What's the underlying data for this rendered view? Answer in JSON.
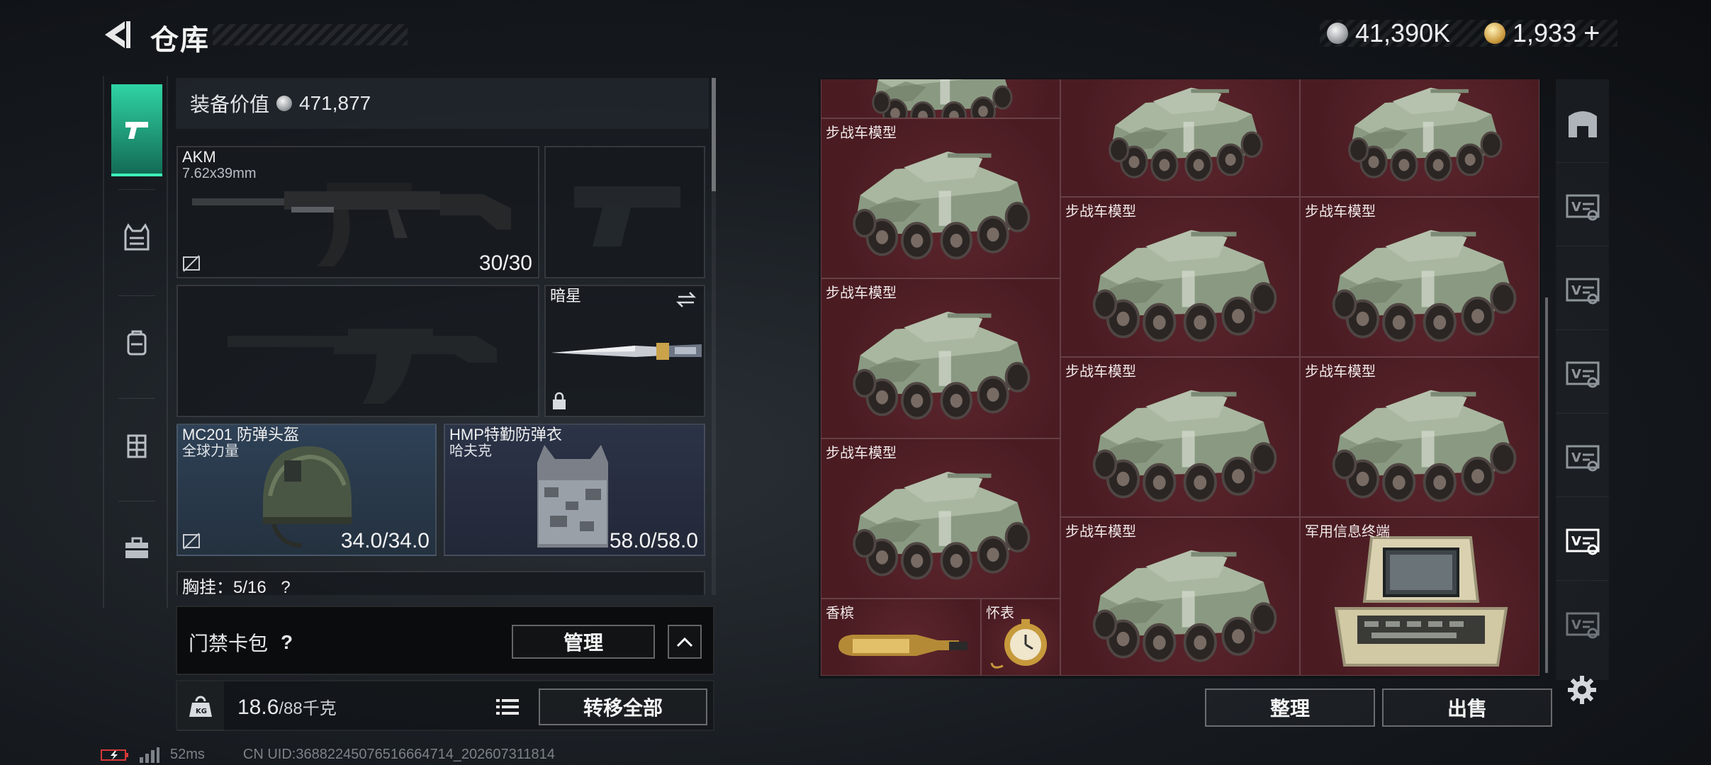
{
  "header": {
    "title": "仓库",
    "silver_amount": "41,390K",
    "gold_amount": "1,933",
    "plus": "+"
  },
  "rail": {
    "items": [
      {
        "name": "weapon"
      },
      {
        "name": "vest"
      },
      {
        "name": "backpack"
      },
      {
        "name": "rig"
      },
      {
        "name": "case"
      }
    ]
  },
  "equip": {
    "value_label": "装备价值",
    "value": "471,877",
    "primary": {
      "name": "AKM",
      "caliber": "7.62x39mm",
      "durability": "30/30"
    },
    "melee": {
      "name": "暗星"
    },
    "helmet": {
      "name": "MC201 防弹头盔",
      "brand": "全球力量",
      "durability": "34.0/34.0"
    },
    "armor": {
      "name": "HMP特勤防弹衣",
      "brand": "哈夫克",
      "durability": "58.0/58.0"
    },
    "chest_rig": "胸挂：5/16",
    "chest_rig_help": "?"
  },
  "keycard": {
    "label": "门禁卡包",
    "help": "?",
    "manage": "管理"
  },
  "weight": {
    "current": "18.6",
    "max": "/88千克",
    "kg_icon": "KG",
    "transfer_all": "转移全部"
  },
  "stash": {
    "cells": [
      {
        "label": ""
      },
      {
        "label": ""
      },
      {
        "label": ""
      },
      {
        "label": "步战车模型"
      },
      {
        "label": "步战车模型"
      },
      {
        "label": "步战车模型"
      },
      {
        "label": "步战车模型"
      },
      {
        "label": "步战车模型"
      },
      {
        "label": "步战车模型"
      },
      {
        "label": "步战车模型"
      },
      {
        "label": "步战车模型"
      },
      {
        "label": "步战车模型"
      },
      {
        "label": "军用信息终端"
      },
      {
        "label": "香槟"
      },
      {
        "label": "怀表"
      }
    ],
    "sort": "整理",
    "sell": "出售"
  },
  "footer": {
    "ping": "52ms",
    "uid": "CN UID:36882245076516664714_202607311814"
  },
  "colors": {
    "accent": "#2fd4a4",
    "stash_bg": "#4a1b22",
    "helmet_slot": "#2e4156",
    "armor_slot": "#2b3347"
  }
}
